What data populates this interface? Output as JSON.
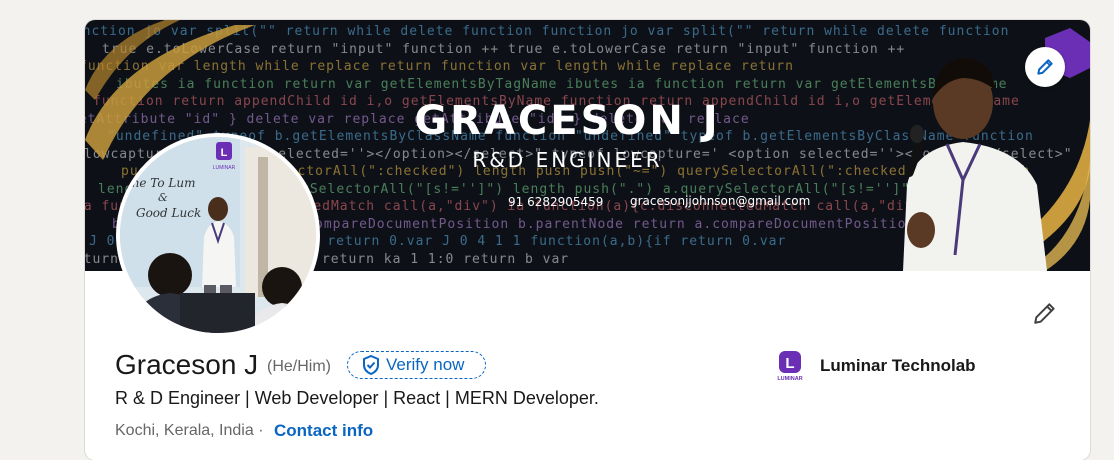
{
  "banner": {
    "name": "GRACESON J",
    "role": "R&D ENGINEER",
    "phone": "91 6282905459",
    "email": "gracesonjjohnson@gmail.com",
    "code_lines": [
      "function jo   var split(\"\"    return  while   delete  function",
      "  true   e.toLowerCase    return \"input\"   function  ++",
      "function  var     length while    replace  return",
      "ibutes ia  function  return   var  getElementsByTagName",
      "function  return  appendChild   id   i,o   getElementsByName",
      "getAttribute \"id\"  }  delete   var  replace",
      "\"undefined\"  typeof  b.getElementsByClassName  function",
      "lowcapture='  <option selected=''></option></select>\" typeof",
      "  push(\"~=\")  querySelectorAll(\":checked\")  length  push",
      "  length  push(\".\")  a.querySelectorAll(\"[s!='']\")",
      "  ia  function(a){c.disconnectedMatch  call(a,\"div\")",
      "  b.parentNode  return  a.compareDocumentPosition",
      "  J  0  4  1 1  function(a,b){if  return  0.var",
      "  return ka   1    1:0   return b  var"
    ],
    "edit_icon": "pencil-icon"
  },
  "profile": {
    "name": "Graceson J",
    "pronouns": "(He/Him)",
    "verify_label": "Verify now",
    "headline": "R & D Engineer | Web Developer | React | MERN Developer.",
    "location": "Kochi, Kerala, India · ",
    "contact_label": "Contact info",
    "company": "Luminar Technolab",
    "avatar_sign_text": "me To Lum & Good Luck",
    "avatar_logo_text": "LUMINAR"
  },
  "colors": {
    "link_blue": "#0a66c2",
    "page_bg": "#f4f2ee",
    "banner_bg": "#0d1117",
    "gold": "#c89b3c",
    "luminar_purple": "#6b2fb5"
  }
}
